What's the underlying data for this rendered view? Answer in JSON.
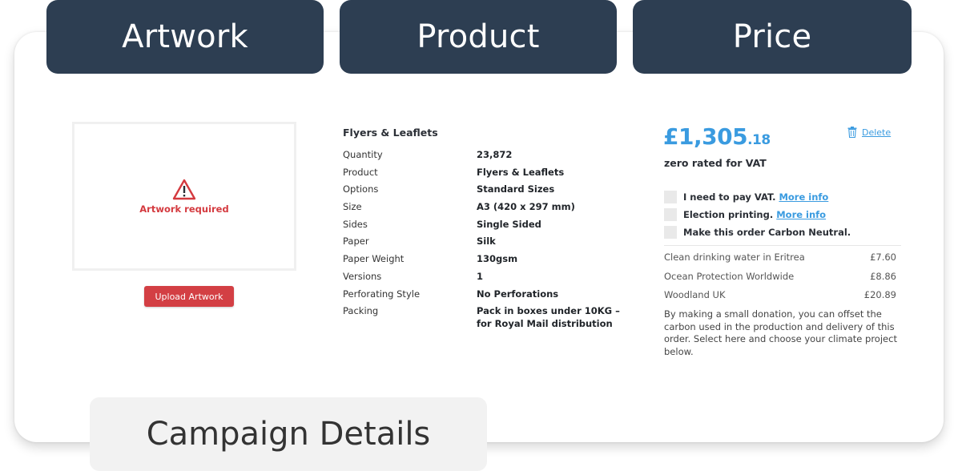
{
  "tabs": {
    "artwork": "Artwork",
    "product": "Product",
    "price": "Price"
  },
  "artwork": {
    "status": "Artwork required",
    "upload_label": "Upload Artwork",
    "icon": "warning-icon"
  },
  "product": {
    "title": "Flyers & Leaflets",
    "specs": [
      {
        "label": "Quantity",
        "value": "23,872"
      },
      {
        "label": "Product",
        "value": "Flyers & Leaflets"
      },
      {
        "label": "Options",
        "value": "Standard Sizes"
      },
      {
        "label": "Size",
        "value": "A3 (420 x 297 mm)"
      },
      {
        "label": "Sides",
        "value": "Single Sided"
      },
      {
        "label": "Paper",
        "value": "Silk"
      },
      {
        "label": "Paper Weight",
        "value": "130gsm"
      },
      {
        "label": "Versions",
        "value": "1"
      },
      {
        "label": "Perforating Style",
        "value": "No Perforations"
      },
      {
        "label": "Packing",
        "value": "Pack in boxes under 10KG – for Royal Mail distribution"
      }
    ]
  },
  "price": {
    "main": "£1,305",
    "pence": ".18",
    "vat_note": "zero rated for VAT",
    "delete_label": "Delete",
    "options": [
      {
        "label": "I need to pay VAT.",
        "link": "More info"
      },
      {
        "label": "Election printing.",
        "link": "More info"
      },
      {
        "label": "Make this order Carbon Neutral.",
        "link": ""
      }
    ],
    "offsets": [
      {
        "name": "Clean drinking water in Eritrea",
        "price": "£7.60"
      },
      {
        "name": "Ocean Protection Worldwide",
        "price": "£8.86"
      },
      {
        "name": "Woodland UK",
        "price": "£20.89"
      }
    ],
    "offset_note": "By making a small donation, you can offset the carbon used in the production and delivery of this order. Select here and choose your climate project below."
  },
  "campaign": {
    "label": "Campaign Details"
  },
  "colors": {
    "tab_bg": "#2d3e52",
    "accent_blue": "#3a9be0",
    "alert_red": "#d33f44"
  }
}
